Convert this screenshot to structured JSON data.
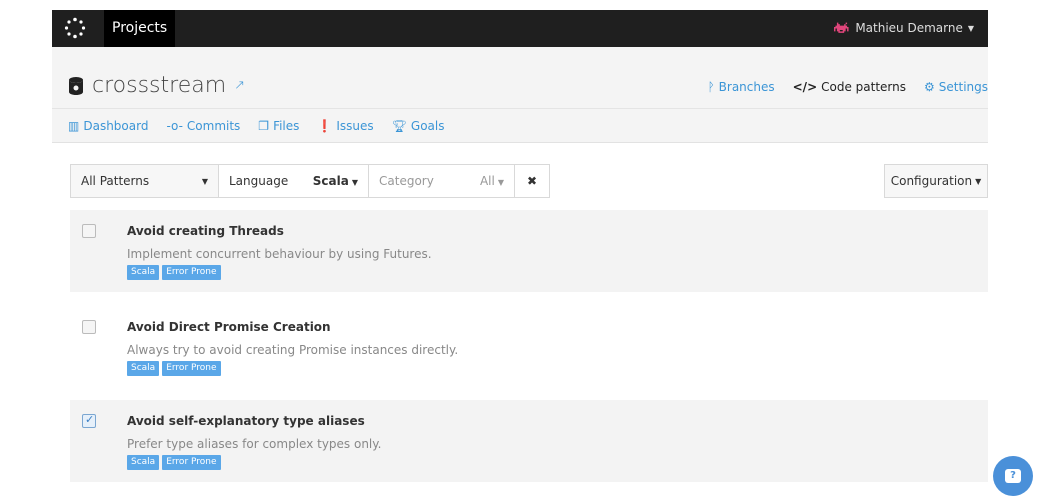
{
  "navbar": {
    "projects_label": "Projects",
    "user_name": "Mathieu Demarne"
  },
  "repo": {
    "name": "crossstream"
  },
  "header_links": {
    "branches": "Branches",
    "code_patterns": "Code patterns",
    "settings": "Settings"
  },
  "subnav": {
    "dashboard": "Dashboard",
    "commits": "Commits",
    "files": "Files",
    "issues": "Issues",
    "goals": "Goals"
  },
  "filters": {
    "patterns": "All Patterns",
    "language_label": "Language",
    "language_value": "Scala",
    "category_label": "Category",
    "category_value": "All"
  },
  "configuration_label": "Configuration",
  "patterns": [
    {
      "title": "Avoid creating Threads",
      "description": "Implement concurrent behaviour by using Futures.",
      "tags": [
        "Scala",
        "Error Prone"
      ],
      "checked": false
    },
    {
      "title": "Avoid Direct Promise Creation",
      "description": "Always try to avoid creating Promise instances directly.",
      "tags": [
        "Scala",
        "Error Prone"
      ],
      "checked": false
    },
    {
      "title": "Avoid self-explanatory type aliases",
      "description": "Prefer type aliases for complex types only.",
      "tags": [
        "Scala",
        "Error Prone"
      ],
      "checked": true
    }
  ],
  "colors": {
    "accent": "#3b95d6",
    "tag": "#5aa7e8",
    "navbar": "#1f1f1f"
  },
  "icons": {
    "logo": "codacy-logo-icon",
    "avatar": "space-invader-icon",
    "repo": "database-icon",
    "external": "external-link-icon",
    "branches": "branch-icon",
    "code_patterns": "code-icon",
    "settings": "gear-icon",
    "dashboard": "bar-chart-icon",
    "commits": "commit-icon",
    "files": "files-icon",
    "issues": "alert-icon",
    "goals": "trophy-icon",
    "help": "chat-icon"
  }
}
